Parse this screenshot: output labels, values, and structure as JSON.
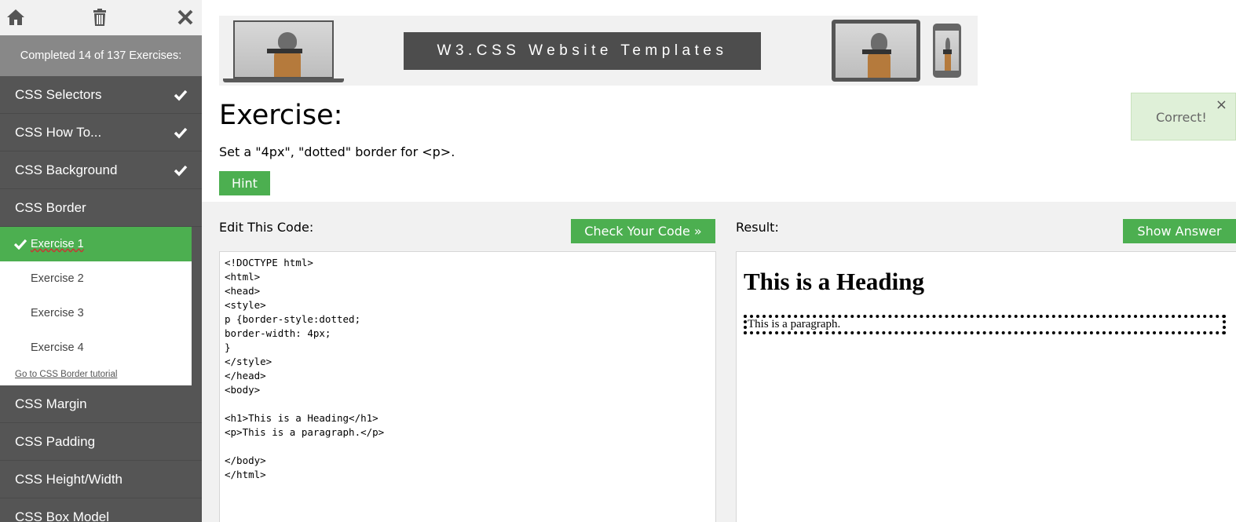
{
  "sidebar": {
    "icons": [
      "home-icon",
      "trash-icon",
      "close-icon"
    ],
    "progress": "Completed 14 of 137 Exercises:",
    "sections_before": [
      {
        "label": "CSS Selectors",
        "done": true
      },
      {
        "label": "CSS How To...",
        "done": true
      },
      {
        "label": "CSS Background",
        "done": true
      },
      {
        "label": "CSS Border",
        "done": false
      }
    ],
    "exercises": [
      {
        "label": "Exercise 1",
        "active": true,
        "done": true
      },
      {
        "label": "Exercise 2",
        "active": false
      },
      {
        "label": "Exercise 3",
        "active": false
      },
      {
        "label": "Exercise 4",
        "active": false
      }
    ],
    "tutorial_link": "Go to CSS Border tutorial",
    "sections_after": [
      {
        "label": "CSS Margin"
      },
      {
        "label": "CSS Padding"
      },
      {
        "label": "CSS Height/Width"
      },
      {
        "label": "CSS Box Model"
      }
    ]
  },
  "banner": {
    "title": "W3.CSS Website Templates"
  },
  "exercise": {
    "title": "Exercise:",
    "description": "Set a \"4px\", \"dotted\" border for <p>.",
    "hint_label": "Hint"
  },
  "toast": {
    "message": "Correct!",
    "close": "×"
  },
  "editor": {
    "label": "Edit This Code:",
    "check_label": "Check Your Code »",
    "code": "<!DOCTYPE html>\n<html>\n<head>\n<style>\np {border-style:dotted;\nborder-width: 4px;\n}\n</style>\n</head>\n<body>\n\n<h1>This is a Heading</h1>\n<p>This is a paragraph.</p>\n\n</body>\n</html>"
  },
  "result": {
    "label": "Result:",
    "show_answer_label": "Show Answer",
    "heading": "This is a Heading",
    "paragraph": "This is a paragraph."
  },
  "colors": {
    "accent_green": "#4caf50",
    "sidebar_bg": "#555555",
    "progress_bg": "#888888",
    "toast_bg": "#dff0d8"
  }
}
